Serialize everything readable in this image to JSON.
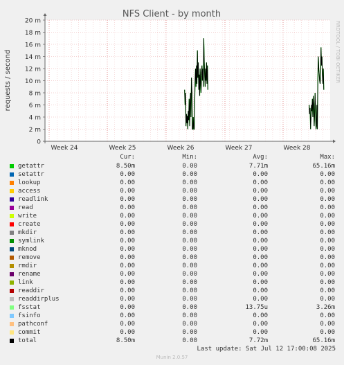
{
  "chart_data": {
    "type": "line",
    "title": "NFS Client - by month",
    "ylabel": "requests / second",
    "ylim": [
      0,
      0.02
    ],
    "y_ticks": [
      "0",
      "2 m",
      "4 m",
      "6 m",
      "8 m",
      "10 m",
      "12 m",
      "14 m",
      "16 m",
      "18 m",
      "20 m"
    ],
    "x_ticks": [
      "Week 24",
      "Week 25",
      "Week 26",
      "Week 27",
      "Week 28"
    ],
    "watermark": "RRDTOOL / TOBI OETIKER",
    "grid": true,
    "series": [
      {
        "name": "getattr",
        "color": "#00cc00",
        "segments": [
          [
            0,
            0,
            0,
            0
          ],
          [
            [
              0.4896,
              0.0085
            ],
            [
              0.4912,
              0.006
            ],
            [
              0.4928,
              0.008
            ],
            [
              0.4944,
              0.0025
            ],
            [
              0.496,
              0.0045
            ],
            [
              0.4976,
              0.003
            ],
            [
              0.4992,
              0.0042
            ],
            [
              0.5008,
              0.002
            ],
            [
              0.5024,
              0.005
            ],
            [
              0.504,
              0.0035
            ],
            [
              0.5056,
              0.007
            ],
            [
              0.5072,
              0.0025
            ],
            [
              0.5088,
              0.006
            ],
            [
              0.5104,
              0.008
            ],
            [
              0.512,
              0.004
            ],
            [
              0.5136,
              0.0105
            ],
            [
              0.5152,
              0.008
            ],
            [
              0.5168,
              0.002
            ],
            [
              0.5184,
              0.002
            ],
            [
              0.52,
              0.004
            ],
            [
              0.5216,
              0.002
            ],
            [
              0.5232,
              0.002
            ],
            [
              0.5248,
              0.006
            ],
            [
              0.5264,
              0.01
            ],
            [
              0.528,
              0.012
            ],
            [
              0.5296,
              0.009
            ],
            [
              0.5312,
              0.0125
            ],
            [
              0.5328,
              0.0095
            ],
            [
              0.5344,
              0.015
            ],
            [
              0.536,
              0.0105
            ],
            [
              0.5376,
              0.013
            ],
            [
              0.5392,
              0.0085
            ],
            [
              0.5408,
              0.011
            ],
            [
              0.5424,
              0.0075
            ],
            [
              0.544,
              0.012
            ],
            [
              0.5456,
              0.0095
            ],
            [
              0.5472,
              0.008
            ],
            [
              0.5488,
              0.011
            ],
            [
              0.5504,
              0.0125
            ],
            [
              0.552,
              0.01
            ],
            [
              0.5536,
              0.012
            ],
            [
              0.5552,
              0.009
            ],
            [
              0.5568,
              0.017
            ],
            [
              0.5584,
              0.013
            ],
            [
              0.56,
              0.011
            ],
            [
              0.5616,
              0.009
            ],
            [
              0.5632,
              0.012
            ],
            [
              0.5648,
              0.01
            ],
            [
              0.5664,
              0.013
            ],
            [
              0.568,
              0.0095
            ],
            [
              0.5696,
              0.0125
            ],
            [
              0.5712,
              0.0085
            ]
          ],
          [
            [
              0.9264,
              0.006
            ],
            [
              0.928,
              0.0045
            ],
            [
              0.9296,
              0.0055
            ],
            [
              0.9312,
              0.002
            ],
            [
              0.9328,
              0.004
            ],
            [
              0.9344,
              0.006
            ],
            [
              0.936,
              0.005
            ],
            [
              0.9376,
              0.007
            ],
            [
              0.9392,
              0.004
            ],
            [
              0.9408,
              0.0075
            ],
            [
              0.9424,
              0.006
            ],
            [
              0.944,
              0.0025
            ],
            [
              0.9456,
              0.0045
            ],
            [
              0.9472,
              0.008
            ],
            [
              0.9488,
              0.005
            ],
            [
              0.9504,
              0.002
            ],
            [
              0.952,
              0.0025
            ],
            [
              0.9536,
              0.006
            ],
            [
              0.9552,
              0.002
            ],
            [
              0.9568,
              0.01
            ],
            [
              0.9584,
              0.014
            ],
            [
              0.96,
              0.012
            ],
            [
              0.9616,
              0.011
            ],
            [
              0.9632,
              0.01
            ],
            [
              0.9648,
              0.0095
            ],
            [
              0.9664,
              0.0115
            ],
            [
              0.968,
              0.0155
            ],
            [
              0.9696,
              0.0125
            ],
            [
              0.9712,
              0.014
            ],
            [
              0.9728,
              0.011
            ],
            [
              0.9744,
              0.0095
            ],
            [
              0.976,
              0.012
            ],
            [
              0.9776,
              0.0085
            ]
          ]
        ]
      }
    ]
  },
  "legend": {
    "headers": {
      "cur": "Cur:",
      "min": "Min:",
      "avg": "Avg:",
      "max": "Max:"
    },
    "rows": [
      {
        "name": "getattr",
        "color": "#00cc00",
        "cur": "8.50m",
        "min": "0.00",
        "avg": "7.71m",
        "max": "65.16m"
      },
      {
        "name": "setattr",
        "color": "#0066b3",
        "cur": "0.00",
        "min": "0.00",
        "avg": "0.00",
        "max": "0.00"
      },
      {
        "name": "lookup",
        "color": "#ff8000",
        "cur": "0.00",
        "min": "0.00",
        "avg": "0.00",
        "max": "0.00"
      },
      {
        "name": "access",
        "color": "#ffcc00",
        "cur": "0.00",
        "min": "0.00",
        "avg": "0.00",
        "max": "0.00"
      },
      {
        "name": "readlink",
        "color": "#330099",
        "cur": "0.00",
        "min": "0.00",
        "avg": "0.00",
        "max": "0.00"
      },
      {
        "name": "read",
        "color": "#990099",
        "cur": "0.00",
        "min": "0.00",
        "avg": "0.00",
        "max": "0.00"
      },
      {
        "name": "write",
        "color": "#ccff00",
        "cur": "0.00",
        "min": "0.00",
        "avg": "0.00",
        "max": "0.00"
      },
      {
        "name": "create",
        "color": "#ff0000",
        "cur": "0.00",
        "min": "0.00",
        "avg": "0.00",
        "max": "0.00"
      },
      {
        "name": "mkdir",
        "color": "#808080",
        "cur": "0.00",
        "min": "0.00",
        "avg": "0.00",
        "max": "0.00"
      },
      {
        "name": "symlink",
        "color": "#008f00",
        "cur": "0.00",
        "min": "0.00",
        "avg": "0.00",
        "max": "0.00"
      },
      {
        "name": "mknod",
        "color": "#00487d",
        "cur": "0.00",
        "min": "0.00",
        "avg": "0.00",
        "max": "0.00"
      },
      {
        "name": "remove",
        "color": "#b35a00",
        "cur": "0.00",
        "min": "0.00",
        "avg": "0.00",
        "max": "0.00"
      },
      {
        "name": "rmdir",
        "color": "#b38f00",
        "cur": "0.00",
        "min": "0.00",
        "avg": "0.00",
        "max": "0.00"
      },
      {
        "name": "rename",
        "color": "#6b006b",
        "cur": "0.00",
        "min": "0.00",
        "avg": "0.00",
        "max": "0.00"
      },
      {
        "name": "link",
        "color": "#8fb300",
        "cur": "0.00",
        "min": "0.00",
        "avg": "0.00",
        "max": "0.00"
      },
      {
        "name": "readdir",
        "color": "#b30000",
        "cur": "0.00",
        "min": "0.00",
        "avg": "0.00",
        "max": "0.00"
      },
      {
        "name": "readdirplus",
        "color": "#bebebe",
        "cur": "0.00",
        "min": "0.00",
        "avg": "0.00",
        "max": "0.00"
      },
      {
        "name": "fsstat",
        "color": "#80ff80",
        "cur": "0.00",
        "min": "0.00",
        "avg": "13.75u",
        "max": "3.26m"
      },
      {
        "name": "fsinfo",
        "color": "#80c9ff",
        "cur": "0.00",
        "min": "0.00",
        "avg": "0.00",
        "max": "0.00"
      },
      {
        "name": "pathconf",
        "color": "#ffc080",
        "cur": "0.00",
        "min": "0.00",
        "avg": "0.00",
        "max": "0.00"
      },
      {
        "name": "commit",
        "color": "#ffe680",
        "cur": "0.00",
        "min": "0.00",
        "avg": "0.00",
        "max": "0.00"
      },
      {
        "name": "total",
        "color": "#000000",
        "cur": "8.50m",
        "min": "0.00",
        "avg": "7.72m",
        "max": "65.16m"
      }
    ]
  },
  "footer": {
    "last_update": "Last update: Sat Jul 12 17:00:08 2025",
    "version": "Munin 2.0.57"
  }
}
